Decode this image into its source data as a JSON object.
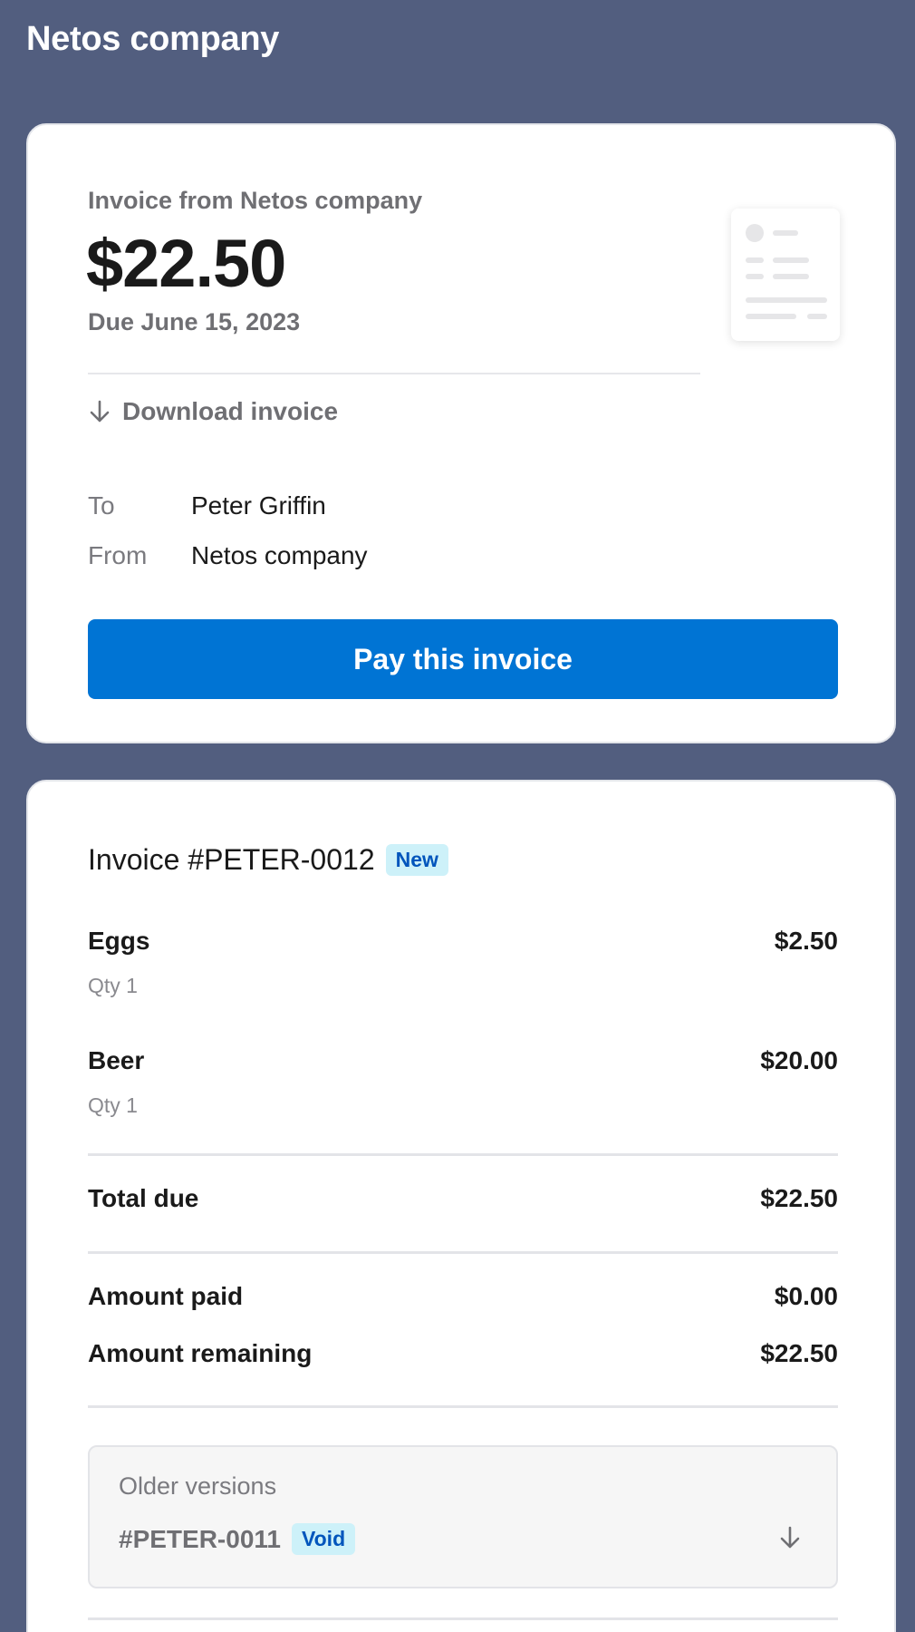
{
  "header": {
    "company": "Netos company"
  },
  "summary": {
    "invoice_from": "Invoice from Netos company",
    "amount": "$22.50",
    "due": "Due June 15, 2023",
    "download_label": "Download invoice",
    "to_label": "To",
    "to_value": "Peter Griffin",
    "from_label": "From",
    "from_value": "Netos company",
    "pay_button": "Pay this invoice",
    "thumbnail_icon": "invoice-document-icon"
  },
  "details": {
    "invoice_number": "Invoice #PETER-0012",
    "status_badge": "New",
    "line_items": [
      {
        "name": "Eggs",
        "price": "$2.50",
        "qty": "Qty 1"
      },
      {
        "name": "Beer",
        "price": "$20.00",
        "qty": "Qty 1"
      }
    ],
    "total_due_label": "Total due",
    "total_due_value": "$22.50",
    "amount_paid_label": "Amount paid",
    "amount_paid_value": "$0.00",
    "amount_remaining_label": "Amount remaining",
    "amount_remaining_value": "$22.50",
    "older_versions": {
      "title": "Older versions",
      "items": [
        {
          "id": "#PETER-0011",
          "status": "Void"
        }
      ]
    }
  },
  "colors": {
    "page_background": "#525e7f",
    "primary_button": "#0074d4",
    "badge_background": "#cdf1f9",
    "badge_text": "#0055bc"
  }
}
